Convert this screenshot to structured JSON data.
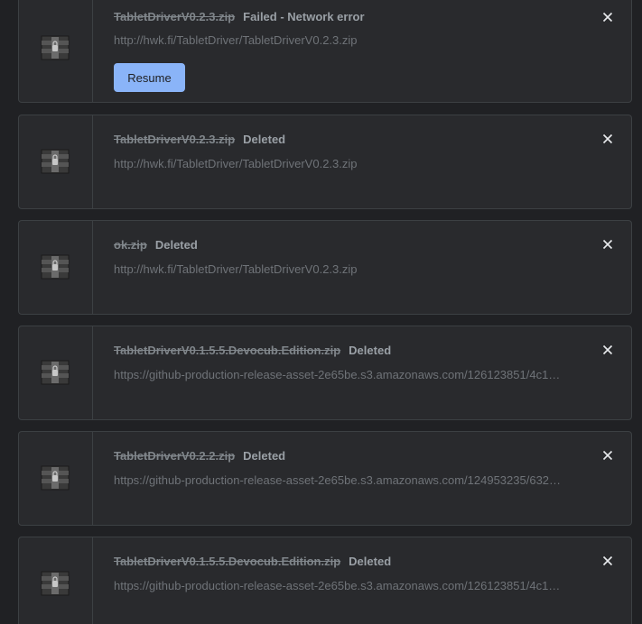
{
  "downloads": [
    {
      "filename": "TabletDriverV0.2.3.zip",
      "status": "Failed - Network error",
      "url": "http://hwk.fi/TabletDriver/TabletDriverV0.2.3.zip",
      "action_label": "Resume"
    },
    {
      "filename": "TabletDriverV0.2.3.zip",
      "status": "Deleted",
      "url": "http://hwk.fi/TabletDriver/TabletDriverV0.2.3.zip"
    },
    {
      "filename": "ok.zip",
      "status": "Deleted",
      "url": "http://hwk.fi/TabletDriver/TabletDriverV0.2.3.zip"
    },
    {
      "filename": "TabletDriverV0.1.5.5.Devocub.Edition.zip",
      "status": "Deleted",
      "url": "https://github-production-release-asset-2e65be.s3.amazonaws.com/126123851/4c1…"
    },
    {
      "filename": "TabletDriverV0.2.2.zip",
      "status": "Deleted",
      "url": "https://github-production-release-asset-2e65be.s3.amazonaws.com/124953235/632…"
    },
    {
      "filename": "TabletDriverV0.1.5.5.Devocub.Edition.zip",
      "status": "Deleted",
      "url": "https://github-production-release-asset-2e65be.s3.amazonaws.com/126123851/4c1…"
    }
  ],
  "icons": {
    "file": "archive-icon",
    "remove": "close-icon"
  },
  "colors": {
    "background": "#202124",
    "card": "#292a2d",
    "accent": "#8ab4f8"
  }
}
